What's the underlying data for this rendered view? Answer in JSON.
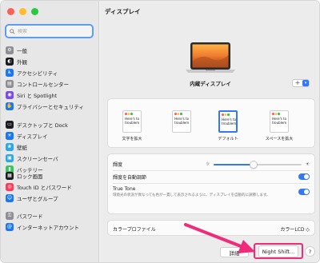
{
  "sidebar": {
    "search_placeholder": "検索",
    "groups": [
      [
        {
          "label": "一般",
          "icon": "gear-icon",
          "color": "#8e8e93"
        },
        {
          "label": "外観",
          "icon": "appearance-icon",
          "color": "#1c1c1e"
        },
        {
          "label": "アクセシビリティ",
          "icon": "accessibility-icon",
          "color": "#1b78f2"
        },
        {
          "label": "コントロールセンター",
          "icon": "control-center-icon",
          "color": "#8e8e93"
        },
        {
          "label": "Siri と Spotlight",
          "icon": "siri-icon",
          "color": "#7b4de0"
        },
        {
          "label": "プライバシーとセキュリティ",
          "icon": "hand-icon",
          "color": "#1b78f2"
        }
      ],
      [
        {
          "label": "デスクトップと Dock",
          "icon": "dock-icon",
          "color": "#1c1c1e"
        },
        {
          "label": "ディスプレイ",
          "icon": "display-icon",
          "color": "#1b78f2"
        },
        {
          "label": "壁紙",
          "icon": "wallpaper-icon",
          "color": "#2ea8e0"
        },
        {
          "label": "スクリーンセーバ",
          "icon": "screensaver-icon",
          "color": "#2ea8e0"
        },
        {
          "label": "バッテリー",
          "icon": "battery-icon",
          "color": "#34c759"
        }
      ],
      [
        {
          "label": "ロック画面",
          "icon": "lock-screen-icon",
          "color": "#1c1c1e"
        },
        {
          "label": "Touch ID とパスワード",
          "icon": "fingerprint-icon",
          "color": "#ff3b5c"
        },
        {
          "label": "ユーザとグループ",
          "icon": "users-icon",
          "color": "#1b78f2"
        }
      ],
      [
        {
          "label": "パスワード",
          "icon": "key-icon",
          "color": "#8e8e93"
        },
        {
          "label": "インターネットアカウント",
          "icon": "at-icon",
          "color": "#1b78f2"
        }
      ]
    ]
  },
  "main": {
    "title": "ディスプレイ",
    "display_name": "内蔵ディスプレイ",
    "add_label": "+",
    "resolutions": [
      {
        "label": "文字を拡大",
        "preview": "Here's to\ntroublem",
        "selected": false
      },
      {
        "label": "",
        "preview": "Here's to\ntroublem",
        "selected": false
      },
      {
        "label": "デフォルト",
        "preview": "Here's to\ntroublem",
        "selected": true
      },
      {
        "label": "スペースを拡大",
        "preview": "Here's to\ntroublem",
        "selected": false
      }
    ],
    "brightness": {
      "label": "輝度",
      "level": 0.45
    },
    "auto_brightness": {
      "label": "輝度を自動調節",
      "on": true
    },
    "true_tone": {
      "label": "True Tone",
      "description": "環境光の状況が異なっても色が一貫して表示されるように、ディスプレイを自動的に調節します。",
      "on": true
    },
    "color_profile": {
      "label": "カラープロファイル",
      "value": "カラーLCD ◇"
    },
    "buttons": {
      "advanced": "詳細",
      "night_shift": "Night Shift...",
      "help": "?"
    }
  },
  "colors": {
    "accent": "#3478f6",
    "highlight": "#ef2b7a"
  }
}
